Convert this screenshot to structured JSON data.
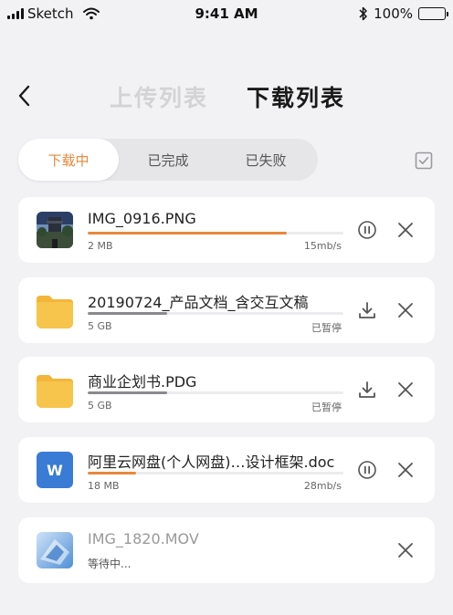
{
  "status_bar": {
    "carrier": "Sketch",
    "time": "9:41 AM",
    "battery": "100%"
  },
  "header": {
    "upload_tab": "上传列表",
    "download_tab": "下载列表"
  },
  "segments": {
    "downloading": "下载中",
    "completed": "已完成",
    "failed": "已失败"
  },
  "colors": {
    "accent": "#e8883a",
    "paused_bar": "#8a8a8e",
    "folder": "#f7c44c",
    "word": "#3a7bd5"
  },
  "items": [
    {
      "name": "IMG_0916.PNG",
      "size": "2 MB",
      "status": "15mb/s",
      "progress": 0.78,
      "icon": "photo-thumbnail",
      "action": "pause-icon"
    },
    {
      "name": "20190724_产品文档_含交互文稿",
      "size": "5 GB",
      "status": "已暂停",
      "progress": 0.31,
      "icon": "folder-icon",
      "action": "download-icon"
    },
    {
      "name": "商业企划书.PDG",
      "size": "5 GB",
      "status": "已暂停",
      "progress": 0.31,
      "icon": "folder-icon",
      "action": "download-icon"
    },
    {
      "name": "阿里云网盘(个人网盘)…设计框架.doc",
      "size": "18 MB",
      "status": "28mb/s",
      "progress": 0.19,
      "icon": "word-doc-icon",
      "icon_letter": "W",
      "action": "pause-icon"
    },
    {
      "name": "IMG_1820.MOV",
      "waiting": "等待中...",
      "icon": "video-thumbnail"
    }
  ]
}
